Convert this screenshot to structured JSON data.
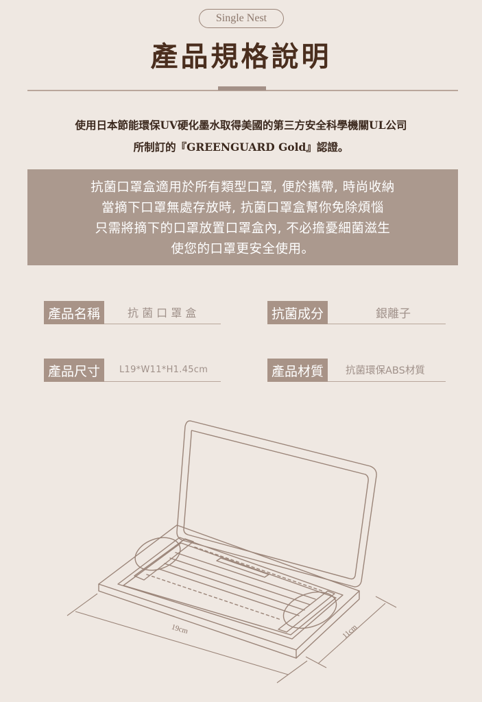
{
  "header": {
    "brand": "Single Nest",
    "title": "產品規格說明"
  },
  "intro": {
    "line1": "使用日本節能環保UV硬化墨水取得美國的第三方安全科學機關UL公司",
    "line2": "所制訂的『GREENGUARD Gold』認證。"
  },
  "banner": {
    "lines": [
      "抗菌口罩盒適用於所有類型口罩, 便於攜帶, 時尚收納",
      "當摘下口罩無處存放時, 抗菌口罩盒幫你免除煩惱",
      "只需將摘下的口罩放置口罩盒內, 不必擔憂細菌滋生",
      "使您的口罩更安全使用。"
    ]
  },
  "specs": {
    "name": {
      "label": "產品名稱",
      "value": "抗 菌 口 罩 盒"
    },
    "ingredient": {
      "label": "抗菌成分",
      "value": "銀離子"
    },
    "size": {
      "label": "產品尺寸",
      "value": "L19*W11*H1.45cm"
    },
    "material": {
      "label": "產品材質",
      "value": "抗菌環保ABS材質"
    }
  },
  "diagram": {
    "length_label": "19cm",
    "width_label": "11cm",
    "line_color": "#9a8478"
  }
}
